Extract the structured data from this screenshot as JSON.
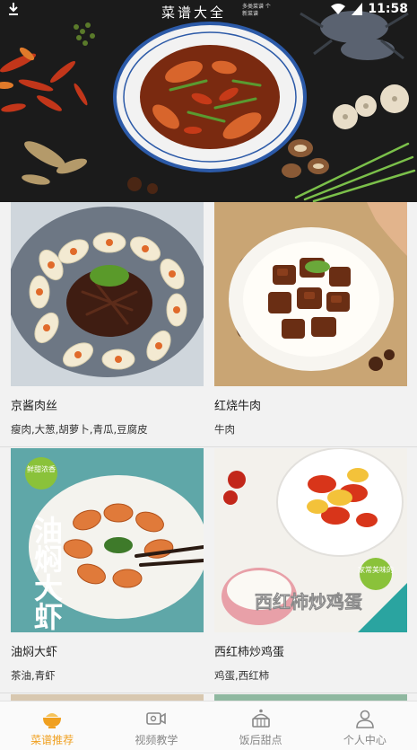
{
  "status_bar": {
    "time": "11:58",
    "app_logo": "菜谱大全",
    "app_logo_sub": "多类菜谱 个新菜谱"
  },
  "recipes": [
    {
      "name": "京酱肉丝",
      "ingredients": "瘦肉,大葱,胡萝卜,青瓜,豆腐皮",
      "photo_icon": "shredded-pork-dish-photo"
    },
    {
      "name": "红烧牛肉",
      "ingredients": "牛肉",
      "photo_icon": "braised-beef-dish-photo"
    },
    {
      "name": "油焖大虾",
      "ingredients": "茶油,青虾",
      "photo_icon": "braised-prawns-dish-photo",
      "photo_caption": "油焖大虾",
      "photo_badge": "鲜甜浓香"
    },
    {
      "name": "西红柿炒鸡蛋",
      "ingredients": "鸡蛋,西红柿",
      "photo_icon": "tomato-egg-dish-photo",
      "photo_caption": "西红柿炒鸡蛋",
      "photo_badge": "家常美味的"
    }
  ],
  "tabs": [
    {
      "label": "菜谱推荐",
      "icon": "recipe-bowl-icon",
      "active": true
    },
    {
      "label": "视频教学",
      "icon": "video-camera-icon",
      "active": false
    },
    {
      "label": "饭后甜点",
      "icon": "cake-icon",
      "active": false
    },
    {
      "label": "个人中心",
      "icon": "person-icon",
      "active": false
    }
  ],
  "colors": {
    "accent": "#f0a020",
    "inactive": "#888888",
    "banner_bg": "#1a1a1a"
  }
}
